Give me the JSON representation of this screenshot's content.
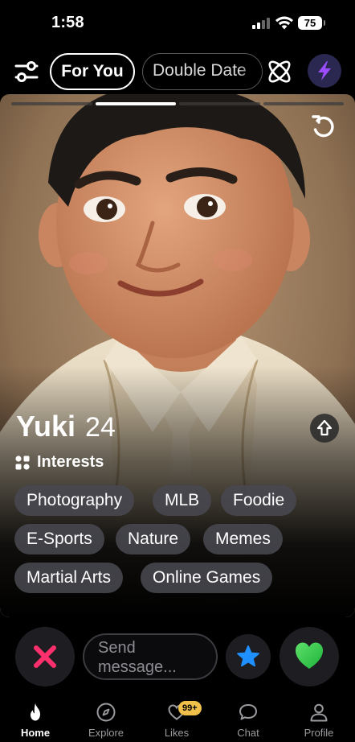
{
  "status_bar": {
    "time": "1:58",
    "battery": "75"
  },
  "top_nav": {
    "filter_icon": "sliders-icon",
    "tabs": [
      {
        "label": "For You",
        "active": true
      },
      {
        "label": "Double Date",
        "active": false
      }
    ],
    "atom_icon": "atom-icon",
    "boost_icon": "lightning-bolt-icon"
  },
  "profile": {
    "name": "Yuki",
    "age": "24",
    "photo_count": 4,
    "photo_index": 2,
    "interests_label": "Interests",
    "interests": [
      "Photography",
      "MLB",
      "Foodie",
      "E-Sports",
      "Nature",
      "Memes",
      "Martial Arts",
      "Online Games"
    ]
  },
  "actions": {
    "message_placeholder": "Send message...",
    "nope_icon": "x-icon",
    "super_like_icon": "star-icon",
    "like_icon": "heart-icon"
  },
  "tab_bar": {
    "items": [
      {
        "label": "Home",
        "icon": "flame-icon",
        "active": true
      },
      {
        "label": "Explore",
        "icon": "compass-icon",
        "active": false
      },
      {
        "label": "Likes",
        "icon": "heart-outline-icon",
        "active": false,
        "badge": "99+"
      },
      {
        "label": "Chat",
        "icon": "chat-bubble-icon",
        "active": false
      },
      {
        "label": "Profile",
        "icon": "person-icon",
        "active": false
      }
    ]
  },
  "colors": {
    "nope": "#ff2f6d",
    "super_like": "#1e90ff",
    "like": "#35d24a",
    "boost": "#9b4dff",
    "badge": "#f0c04a"
  }
}
